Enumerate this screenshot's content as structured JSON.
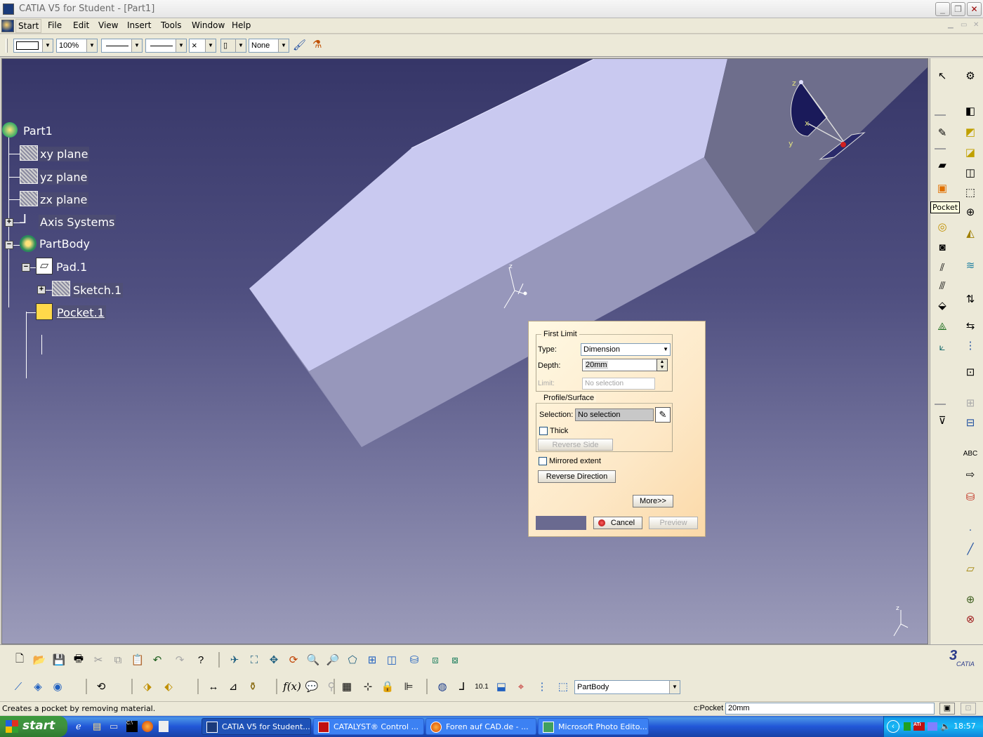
{
  "window": {
    "title": "CATIA V5 for Student - [Part1]"
  },
  "menu": {
    "items": [
      "Start",
      "File",
      "Edit",
      "View",
      "Insert",
      "Tools",
      "Window",
      "Help"
    ]
  },
  "props_toolbar": {
    "zoom": "100%",
    "layer": "None"
  },
  "tree": {
    "root": "Part1",
    "xy_plane": "xy plane",
    "yz_plane": "yz plane",
    "zx_plane": "zx plane",
    "axis_systems": "Axis Systems",
    "part_body": "PartBody",
    "pad": "Pad.1",
    "sketch": "Sketch.1",
    "pocket": "Pocket.1"
  },
  "compass": {
    "z": "z",
    "x": "x",
    "y": "y"
  },
  "tooltip": {
    "pocket": "Pocket"
  },
  "dialog": {
    "first_limit": {
      "title": "First Limit",
      "type_label": "Type:",
      "type_value": "Dimension",
      "depth_label": "Depth:",
      "depth_value": "20mm",
      "limit_label": "Limit:",
      "limit_value": "No selection"
    },
    "profile": {
      "title": "Profile/Surface",
      "selection_label": "Selection:",
      "selection_value": "No selection",
      "thick_label": "Thick",
      "reverse_side": "Reverse Side"
    },
    "mirrored_label": "Mirrored extent",
    "reverse_direction": "Reverse Direction",
    "more": "More>>",
    "cancel": "Cancel",
    "preview": "Preview"
  },
  "bottom_toolbar": {
    "current_body": "PartBody",
    "brand": "CATIA"
  },
  "status": {
    "message": "Creates a pocket by removing material.",
    "prompt": "c:Pocket",
    "power_input": "20mm"
  },
  "taskbar": {
    "start": "start",
    "tasks": [
      {
        "label": "CATIA V5 for Student...",
        "active": true
      },
      {
        "label": "CATALYST® Control ...",
        "active": false
      },
      {
        "label": "Foren auf CAD.de - ...",
        "active": false
      },
      {
        "label": "Microsoft Photo Edito...",
        "active": false
      }
    ],
    "clock": "18:57"
  },
  "colors": {
    "viewport_top": "#363668",
    "viewport_bottom": "#9c9cba",
    "part_top_face": "#c9c9f0",
    "part_side_face": "#9797bb",
    "part_end_face": "#6e6e8c",
    "taskbar_blue": "#2157d7",
    "start_green": "#3c9a3c"
  }
}
